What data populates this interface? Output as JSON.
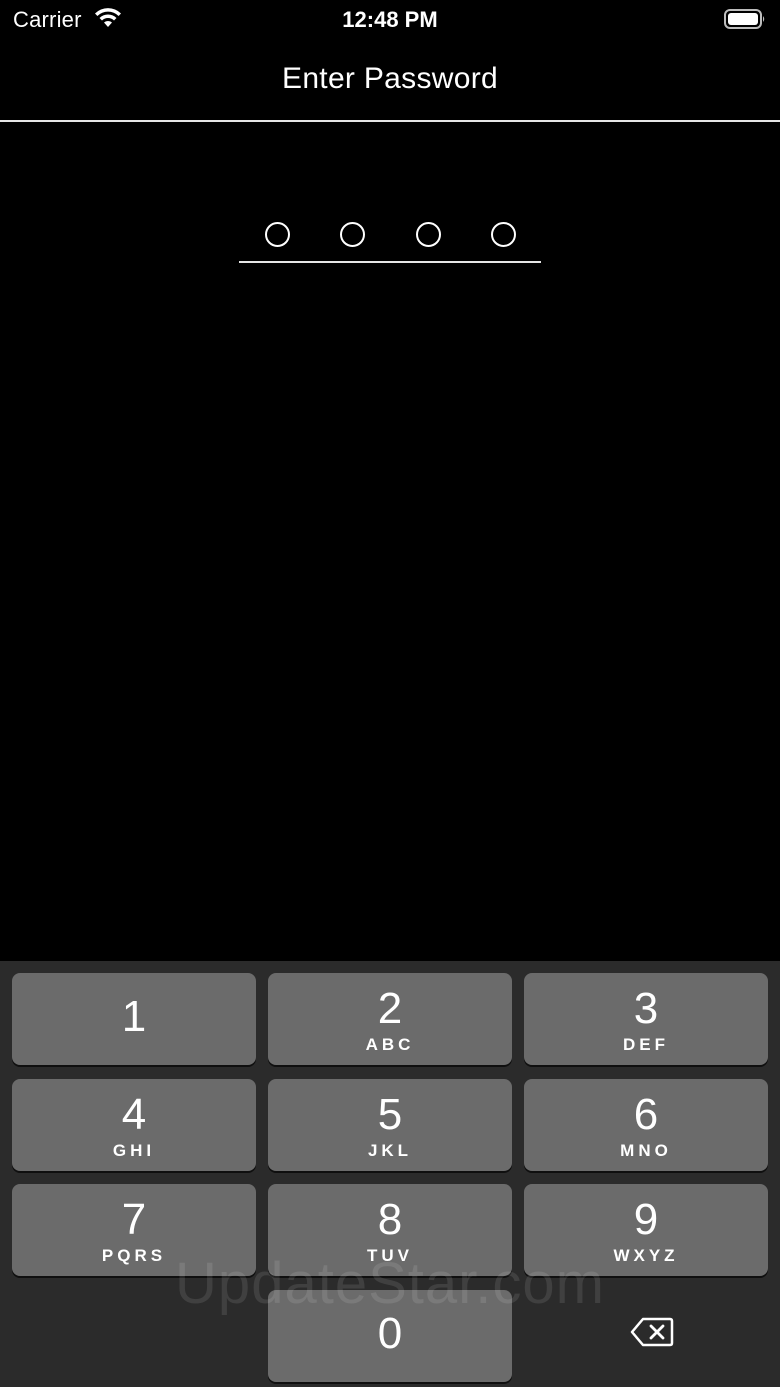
{
  "status_bar": {
    "carrier": "Carrier",
    "time": "12:48 PM",
    "wifi_icon": "wifi-icon",
    "battery_icon": "battery-full-icon"
  },
  "header": {
    "title": "Enter Password"
  },
  "pin": {
    "length": 4,
    "entered": 0
  },
  "keypad": {
    "keys": [
      {
        "digit": "1",
        "letters": ""
      },
      {
        "digit": "2",
        "letters": "ABC"
      },
      {
        "digit": "3",
        "letters": "DEF"
      },
      {
        "digit": "4",
        "letters": "GHI"
      },
      {
        "digit": "5",
        "letters": "JKL"
      },
      {
        "digit": "6",
        "letters": "MNO"
      },
      {
        "digit": "7",
        "letters": "PQRS"
      },
      {
        "digit": "8",
        "letters": "TUV"
      },
      {
        "digit": "9",
        "letters": "WXYZ"
      },
      {
        "digit": "0",
        "letters": ""
      }
    ],
    "delete_icon": "backspace-icon"
  },
  "watermark": "UpdateStar.com",
  "colors": {
    "background": "#000000",
    "keypad_background": "#2b2b2b",
    "key_background": "#6b6b6b",
    "text": "#ffffff"
  }
}
